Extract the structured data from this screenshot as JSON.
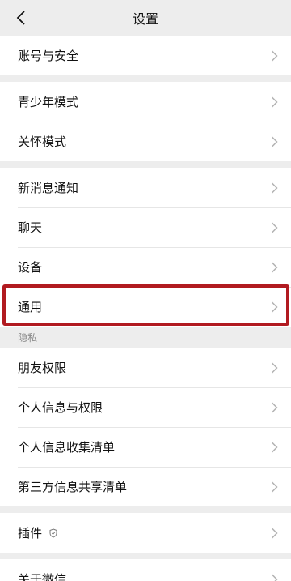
{
  "header": {
    "title": "设置"
  },
  "groups": [
    {
      "items": [
        {
          "label": "账号与安全"
        }
      ]
    },
    {
      "items": [
        {
          "label": "青少年模式"
        },
        {
          "label": "关怀模式"
        }
      ]
    },
    {
      "items": [
        {
          "label": "新消息通知"
        },
        {
          "label": "聊天"
        },
        {
          "label": "设备"
        },
        {
          "label": "通用"
        }
      ]
    },
    {
      "section_label": "隐私",
      "items": [
        {
          "label": "朋友权限"
        },
        {
          "label": "个人信息与权限"
        },
        {
          "label": "个人信息收集清单"
        },
        {
          "label": "第三方信息共享清单"
        }
      ]
    },
    {
      "items": [
        {
          "label": "插件",
          "badge": "shield-icon"
        }
      ]
    },
    {
      "items": [
        {
          "label": "关于微信"
        }
      ]
    }
  ],
  "colors": {
    "highlight_border": "#b11a20",
    "background": "#ededed"
  }
}
